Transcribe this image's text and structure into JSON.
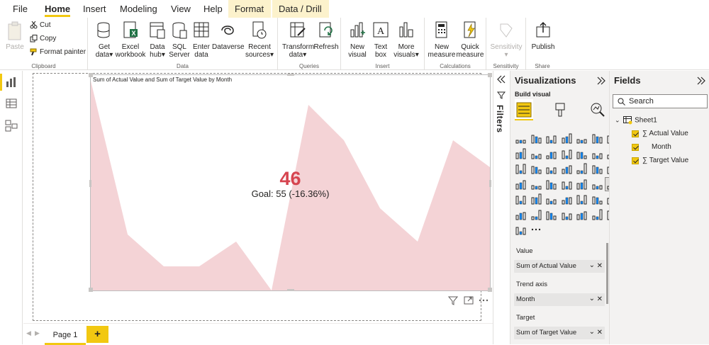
{
  "menu": {
    "tabs": [
      "File",
      "Home",
      "Insert",
      "Modeling",
      "View",
      "Help",
      "Format",
      "Data / Drill"
    ],
    "active": "Home"
  },
  "ribbon": {
    "clipboard": {
      "paste": "Paste",
      "cut": "Cut",
      "copy": "Copy",
      "format_painter": "Format painter",
      "label": "Clipboard"
    },
    "data": {
      "get_data": "Get data",
      "excel": "Excel workbook",
      "data_hub": "Data hub",
      "sql": "SQL Server",
      "enter_data": "Enter data",
      "dataverse": "Dataverse",
      "recent": "Recent sources",
      "label": "Data"
    },
    "queries": {
      "transform": "Transform data",
      "refresh": "Refresh",
      "label": "Queries"
    },
    "insert": {
      "new_visual": "New visual",
      "text_box": "Text box",
      "more_visuals": "More visuals",
      "label": "Insert"
    },
    "calculations": {
      "new_measure": "New measure",
      "quick_measure": "Quick measure",
      "label": "Calculations"
    },
    "sensitivity": {
      "sensitivity": "Sensitivity",
      "label": "Sensitivity"
    },
    "share": {
      "publish": "Publish",
      "label": "Share"
    }
  },
  "visual": {
    "title": "Sum of Actual Value and Sum of Target Value by Month",
    "kpi_value": "46",
    "goal_text": "Goal: 55 (-16.36%)",
    "trend_color": "#f4d3d6",
    "kpi_color": "#d64550"
  },
  "pages": {
    "tab": "Page 1",
    "add": "+"
  },
  "filters": {
    "label": "Filters"
  },
  "visualizations": {
    "title": "Visualizations",
    "build_visual": "Build visual",
    "wells": [
      {
        "label": "Value",
        "field": "Sum of Actual Value"
      },
      {
        "label": "Trend axis",
        "field": "Month"
      },
      {
        "label": "Target",
        "field": "Sum of Target Value"
      }
    ]
  },
  "fields": {
    "title": "Fields",
    "search_placeholder": "Search",
    "table": "Sheet1",
    "items": [
      {
        "name": "Actual Value",
        "sigma": "∑"
      },
      {
        "name": "Month",
        "sigma": ""
      },
      {
        "name": "Target Value",
        "sigma": "∑"
      }
    ]
  }
}
